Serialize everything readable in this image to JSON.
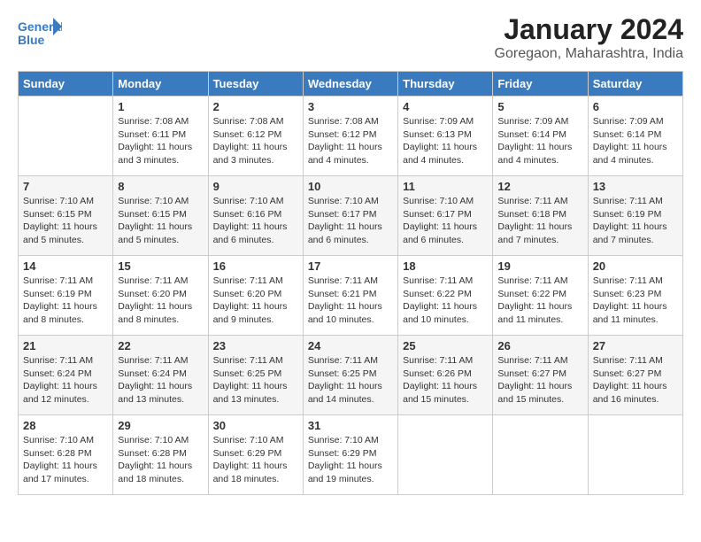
{
  "logo": {
    "line1": "General",
    "line2": "Blue"
  },
  "title": "January 2024",
  "location": "Goregaon, Maharashtra, India",
  "headers": [
    "Sunday",
    "Monday",
    "Tuesday",
    "Wednesday",
    "Thursday",
    "Friday",
    "Saturday"
  ],
  "weeks": [
    [
      {
        "day": "",
        "info": ""
      },
      {
        "day": "1",
        "info": "Sunrise: 7:08 AM\nSunset: 6:11 PM\nDaylight: 11 hours\nand 3 minutes."
      },
      {
        "day": "2",
        "info": "Sunrise: 7:08 AM\nSunset: 6:12 PM\nDaylight: 11 hours\nand 3 minutes."
      },
      {
        "day": "3",
        "info": "Sunrise: 7:08 AM\nSunset: 6:12 PM\nDaylight: 11 hours\nand 4 minutes."
      },
      {
        "day": "4",
        "info": "Sunrise: 7:09 AM\nSunset: 6:13 PM\nDaylight: 11 hours\nand 4 minutes."
      },
      {
        "day": "5",
        "info": "Sunrise: 7:09 AM\nSunset: 6:14 PM\nDaylight: 11 hours\nand 4 minutes."
      },
      {
        "day": "6",
        "info": "Sunrise: 7:09 AM\nSunset: 6:14 PM\nDaylight: 11 hours\nand 4 minutes."
      }
    ],
    [
      {
        "day": "7",
        "info": "Sunrise: 7:10 AM\nSunset: 6:15 PM\nDaylight: 11 hours\nand 5 minutes."
      },
      {
        "day": "8",
        "info": "Sunrise: 7:10 AM\nSunset: 6:15 PM\nDaylight: 11 hours\nand 5 minutes."
      },
      {
        "day": "9",
        "info": "Sunrise: 7:10 AM\nSunset: 6:16 PM\nDaylight: 11 hours\nand 6 minutes."
      },
      {
        "day": "10",
        "info": "Sunrise: 7:10 AM\nSunset: 6:17 PM\nDaylight: 11 hours\nand 6 minutes."
      },
      {
        "day": "11",
        "info": "Sunrise: 7:10 AM\nSunset: 6:17 PM\nDaylight: 11 hours\nand 6 minutes."
      },
      {
        "day": "12",
        "info": "Sunrise: 7:11 AM\nSunset: 6:18 PM\nDaylight: 11 hours\nand 7 minutes."
      },
      {
        "day": "13",
        "info": "Sunrise: 7:11 AM\nSunset: 6:19 PM\nDaylight: 11 hours\nand 7 minutes."
      }
    ],
    [
      {
        "day": "14",
        "info": "Sunrise: 7:11 AM\nSunset: 6:19 PM\nDaylight: 11 hours\nand 8 minutes."
      },
      {
        "day": "15",
        "info": "Sunrise: 7:11 AM\nSunset: 6:20 PM\nDaylight: 11 hours\nand 8 minutes."
      },
      {
        "day": "16",
        "info": "Sunrise: 7:11 AM\nSunset: 6:20 PM\nDaylight: 11 hours\nand 9 minutes."
      },
      {
        "day": "17",
        "info": "Sunrise: 7:11 AM\nSunset: 6:21 PM\nDaylight: 11 hours\nand 10 minutes."
      },
      {
        "day": "18",
        "info": "Sunrise: 7:11 AM\nSunset: 6:22 PM\nDaylight: 11 hours\nand 10 minutes."
      },
      {
        "day": "19",
        "info": "Sunrise: 7:11 AM\nSunset: 6:22 PM\nDaylight: 11 hours\nand 11 minutes."
      },
      {
        "day": "20",
        "info": "Sunrise: 7:11 AM\nSunset: 6:23 PM\nDaylight: 11 hours\nand 11 minutes."
      }
    ],
    [
      {
        "day": "21",
        "info": "Sunrise: 7:11 AM\nSunset: 6:24 PM\nDaylight: 11 hours\nand 12 minutes."
      },
      {
        "day": "22",
        "info": "Sunrise: 7:11 AM\nSunset: 6:24 PM\nDaylight: 11 hours\nand 13 minutes."
      },
      {
        "day": "23",
        "info": "Sunrise: 7:11 AM\nSunset: 6:25 PM\nDaylight: 11 hours\nand 13 minutes."
      },
      {
        "day": "24",
        "info": "Sunrise: 7:11 AM\nSunset: 6:25 PM\nDaylight: 11 hours\nand 14 minutes."
      },
      {
        "day": "25",
        "info": "Sunrise: 7:11 AM\nSunset: 6:26 PM\nDaylight: 11 hours\nand 15 minutes."
      },
      {
        "day": "26",
        "info": "Sunrise: 7:11 AM\nSunset: 6:27 PM\nDaylight: 11 hours\nand 15 minutes."
      },
      {
        "day": "27",
        "info": "Sunrise: 7:11 AM\nSunset: 6:27 PM\nDaylight: 11 hours\nand 16 minutes."
      }
    ],
    [
      {
        "day": "28",
        "info": "Sunrise: 7:10 AM\nSunset: 6:28 PM\nDaylight: 11 hours\nand 17 minutes."
      },
      {
        "day": "29",
        "info": "Sunrise: 7:10 AM\nSunset: 6:28 PM\nDaylight: 11 hours\nand 18 minutes."
      },
      {
        "day": "30",
        "info": "Sunrise: 7:10 AM\nSunset: 6:29 PM\nDaylight: 11 hours\nand 18 minutes."
      },
      {
        "day": "31",
        "info": "Sunrise: 7:10 AM\nSunset: 6:29 PM\nDaylight: 11 hours\nand 19 minutes."
      },
      {
        "day": "",
        "info": ""
      },
      {
        "day": "",
        "info": ""
      },
      {
        "day": "",
        "info": ""
      }
    ]
  ]
}
